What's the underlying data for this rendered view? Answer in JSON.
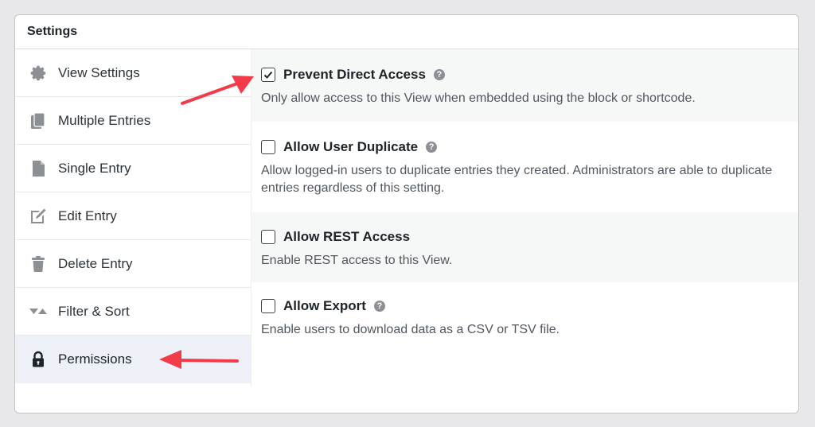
{
  "panel": {
    "title": "Settings"
  },
  "sidebar": {
    "items": [
      {
        "label": "View Settings",
        "icon": "gear-icon",
        "active": false
      },
      {
        "label": "Multiple Entries",
        "icon": "multiple-documents-icon",
        "active": false
      },
      {
        "label": "Single Entry",
        "icon": "document-icon",
        "active": false
      },
      {
        "label": "Edit Entry",
        "icon": "edit-icon",
        "active": false
      },
      {
        "label": "Delete Entry",
        "icon": "trash-icon",
        "active": false
      },
      {
        "label": "Filter & Sort",
        "icon": "filter-sort-icon",
        "active": false
      },
      {
        "label": "Permissions",
        "icon": "lock-icon",
        "active": true
      }
    ]
  },
  "settings": [
    {
      "label": "Prevent Direct Access",
      "checked": true,
      "help": true,
      "description": "Only allow access to this View when embedded using the block or shortcode."
    },
    {
      "label": "Allow User Duplicate",
      "checked": false,
      "help": true,
      "description": "Allow logged-in users to duplicate entries they created. Administrators are able to duplicate entries regardless of this setting."
    },
    {
      "label": "Allow REST Access",
      "checked": false,
      "help": false,
      "description": "Enable REST access to this View."
    },
    {
      "label": "Allow Export",
      "checked": false,
      "help": true,
      "description": "Enable users to download data as a CSV or TSV file."
    }
  ],
  "help_glyph": "?",
  "colors": {
    "icon": "#8c8f94",
    "active_bg": "#eef0f8",
    "arrow": "#f23b4a",
    "shaded_row": "#f6f7f7"
  }
}
